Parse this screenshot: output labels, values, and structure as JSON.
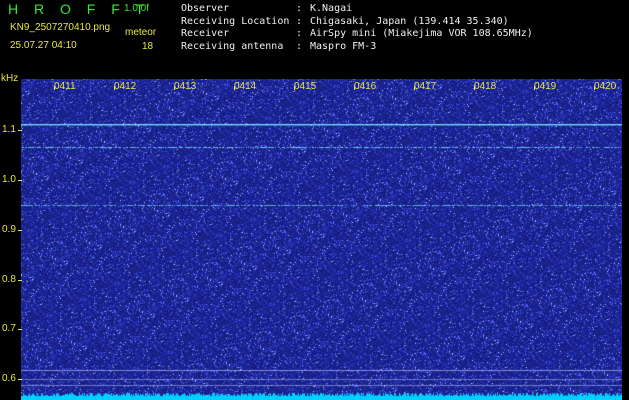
{
  "header": {
    "app_title": "H R O F F T",
    "version": "1.0.0f",
    "file_name": "KN9_2507270410.png",
    "timestamp": "25.07.27 04:10",
    "mode": "meteor",
    "count": "18"
  },
  "info": [
    {
      "label": "Observer",
      "value": "K.Nagai"
    },
    {
      "label": "Receiving Location",
      "value": "Chigasaki, Japan (139.414 35.340)"
    },
    {
      "label": "Receiver",
      "value": "AirSpy mini (Miakejima VOR 108.65MHz)"
    },
    {
      "label": "Receiving antenna",
      "value": "Maspro FM-3"
    }
  ],
  "spectrogram": {
    "y_axis_label": "kHz",
    "y_ticks": [
      "1.1",
      "1.0",
      "0.9",
      "0.8",
      "0.7",
      "0.6"
    ],
    "x_ticks": [
      "0411",
      "0412",
      "0413",
      "0414",
      "0415",
      "0416",
      "0417",
      "0418",
      "0419",
      "0420"
    ],
    "colors": {
      "background": "#121a8a",
      "noise": "#6a78ff",
      "line": "#7ce6ff",
      "axis_text": "#e8e840",
      "floor": "#00d0ff"
    }
  }
}
